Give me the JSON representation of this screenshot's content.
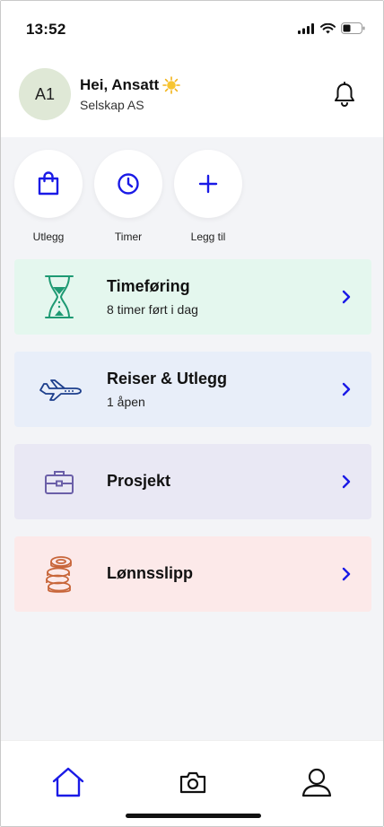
{
  "status": {
    "time": "13:52"
  },
  "header": {
    "avatar_initials": "A1",
    "greeting": "Hei, Ansatt",
    "company": "Selskap AS"
  },
  "quick_actions": [
    {
      "label": "Utlegg",
      "icon": "shopping-bag-icon"
    },
    {
      "label": "Timer",
      "icon": "clock-icon"
    },
    {
      "label": "Legg til",
      "icon": "plus-icon"
    }
  ],
  "cards": [
    {
      "title": "Timeføring",
      "subtitle": "8 timer ført i dag",
      "icon": "hourglass-icon",
      "color": "#e4f7ee"
    },
    {
      "title": "Reiser & Utlegg",
      "subtitle": "1 åpen",
      "icon": "airplane-icon",
      "color": "#e8eef9"
    },
    {
      "title": "Prosjekt",
      "subtitle": "",
      "icon": "briefcase-icon",
      "color": "#e9e8f4"
    },
    {
      "title": "Lønnsslipp",
      "subtitle": "",
      "icon": "coins-icon",
      "color": "#fce9e9"
    }
  ],
  "tabbar": {
    "items": [
      "home-icon",
      "camera-icon",
      "profile-icon"
    ],
    "active": "home-icon"
  },
  "colors": {
    "accent": "#1a1ae6",
    "background": "#f3f4f7"
  }
}
